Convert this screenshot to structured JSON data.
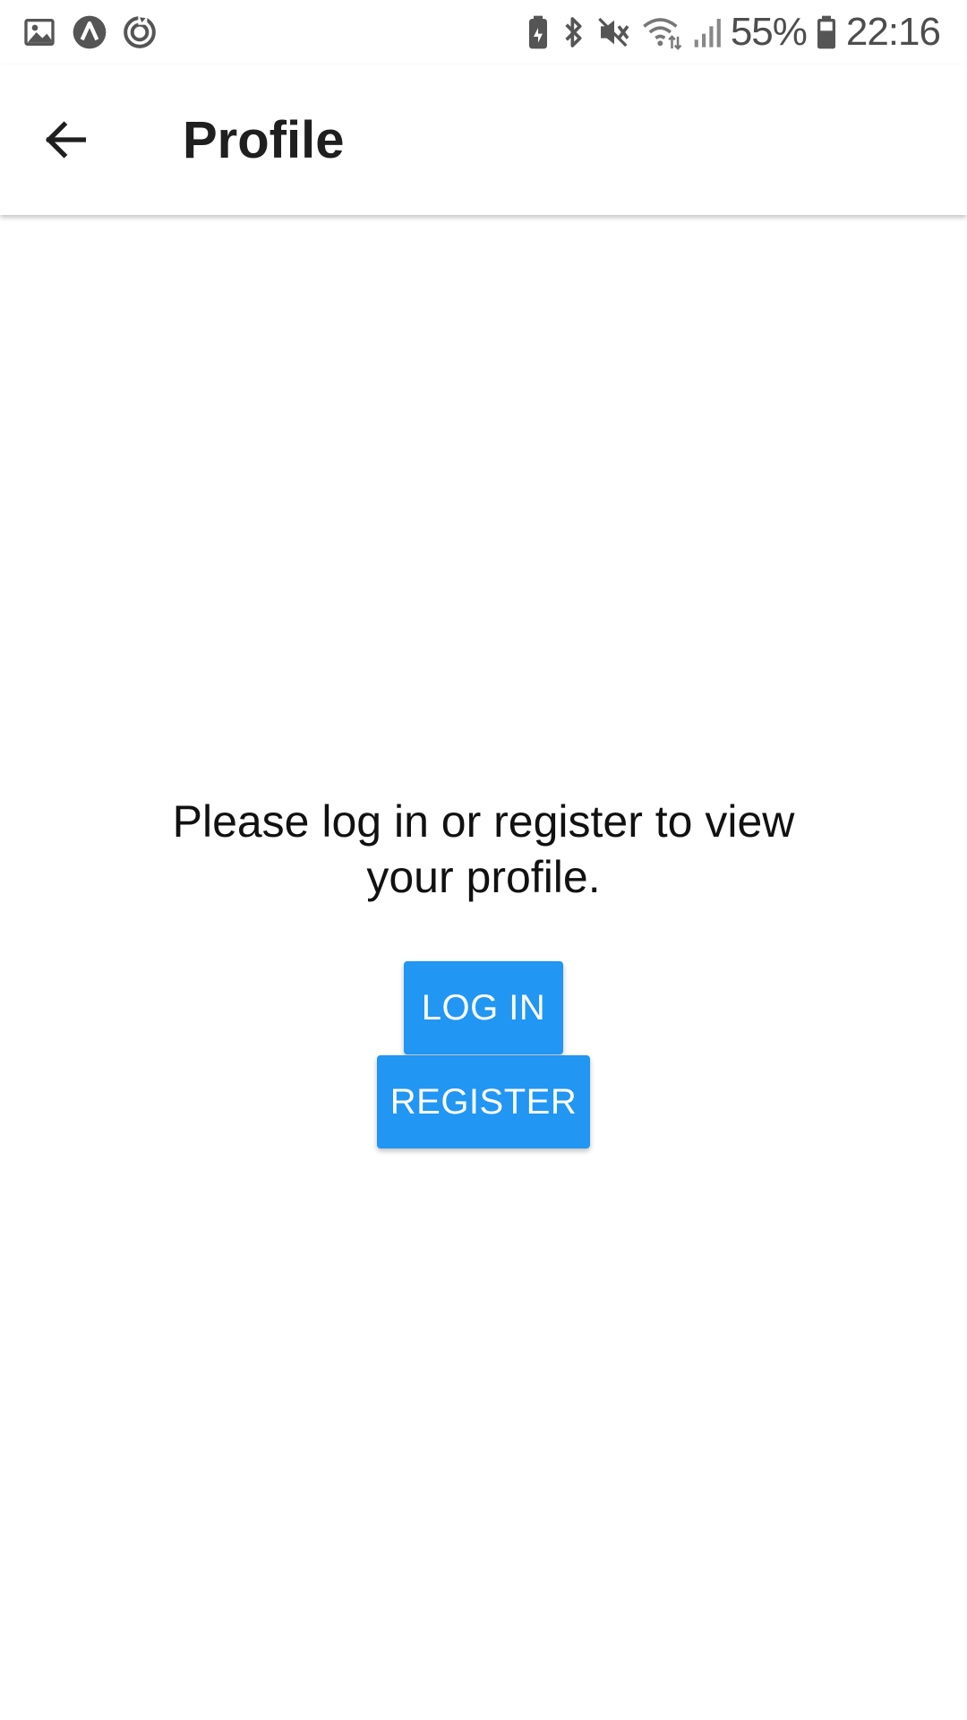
{
  "status_bar": {
    "battery_percent": "55%",
    "time": "22:16",
    "left_icons": [
      "gallery-icon",
      "app-circle-icon",
      "sync-icon"
    ],
    "right_icons": [
      "battery-saver-icon",
      "bluetooth-icon",
      "vibrate-icon",
      "wifi-icon",
      "signal-icon",
      "battery-icon"
    ]
  },
  "app_bar": {
    "title": "Profile",
    "back_icon": "arrow-left-icon"
  },
  "main": {
    "message": "Please log in or register to view your profile.",
    "login_label": "LOG IN",
    "register_label": "REGISTER"
  },
  "colors": {
    "accent": "#2196f3",
    "title_text": "#1f1f1f",
    "status_text": "#4d4d4d"
  }
}
